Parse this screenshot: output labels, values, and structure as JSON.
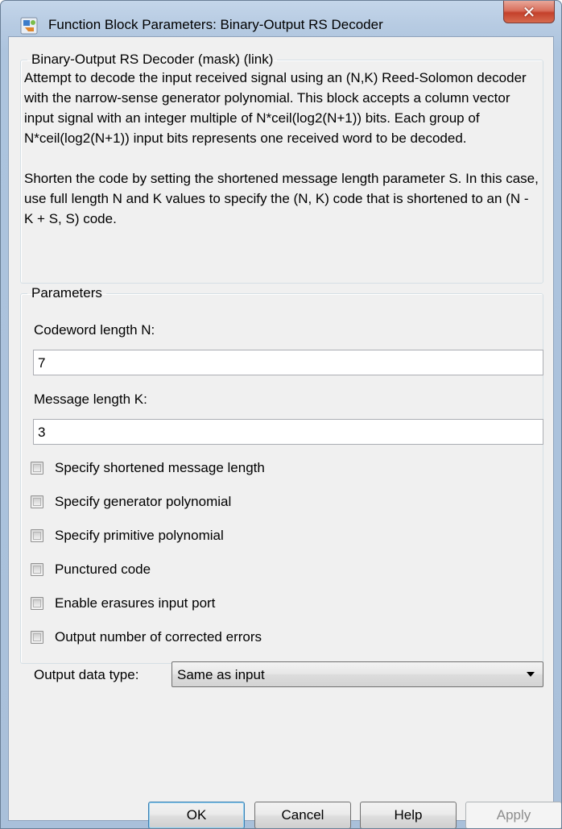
{
  "window": {
    "title": "Function Block Parameters: Binary-Output RS Decoder"
  },
  "description": {
    "group_title": "Binary-Output RS Decoder (mask) (link)",
    "paragraph1": "Attempt to decode the input received signal using an (N,K) Reed-Solomon decoder with the narrow-sense generator polynomial.  This block accepts a column vector input signal with an integer multiple of N*ceil(log2(N+1)) bits.  Each group of N*ceil(log2(N+1)) input bits represents one received word to be decoded.",
    "paragraph2": "Shorten the code by setting the shortened message length parameter S. In this case, use full length N and K values to specify the (N, K) code that is shortened to an (N - K + S, S) code."
  },
  "parameters": {
    "group_title": "Parameters",
    "codeword_length": {
      "label": "Codeword length N:",
      "value": "7"
    },
    "message_length": {
      "label": "Message length K:",
      "value": "3"
    },
    "checkboxes": [
      {
        "label": "Specify shortened message length",
        "checked": false
      },
      {
        "label": "Specify generator polynomial",
        "checked": false
      },
      {
        "label": "Specify primitive polynomial",
        "checked": false
      },
      {
        "label": "Punctured code",
        "checked": false
      },
      {
        "label": "Enable erasures input port",
        "checked": false
      },
      {
        "label": "Output number of corrected errors",
        "checked": false
      }
    ],
    "output_data_type": {
      "label": "Output data type:",
      "value": "Same as input"
    }
  },
  "buttons": {
    "ok": "OK",
    "cancel": "Cancel",
    "help": "Help",
    "apply": "Apply"
  },
  "colors": {
    "title_bar": "#b7cbe2",
    "client_bg": "#f0f0f0",
    "close_button": "#c4412b"
  }
}
